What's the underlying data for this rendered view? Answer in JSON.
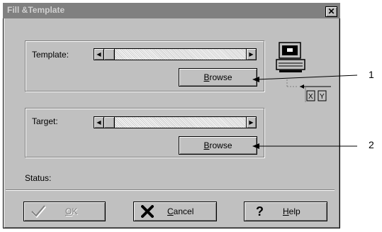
{
  "window": {
    "title": "Fill &Template",
    "close_glyph": "✕"
  },
  "template_group": {
    "label": "Template:",
    "browse_button": {
      "mnemonic": "B",
      "rest": "rowse"
    }
  },
  "target_group": {
    "label": "Target:",
    "browse_button": {
      "mnemonic": "B",
      "rest": "rowse"
    }
  },
  "status": {
    "label": "Status:"
  },
  "buttons": {
    "ok": {
      "mnemonic": "O",
      "rest": "K",
      "enabled": false
    },
    "cancel": {
      "mnemonic": "C",
      "rest": "ancel"
    },
    "help": {
      "mnemonic": "H",
      "rest": "elp",
      "icon": "?"
    }
  },
  "graphic": {
    "x_label": "X",
    "y_label": "Y"
  },
  "callouts": [
    "1",
    "2"
  ],
  "icons": {
    "close": "close-icon",
    "computer": "computer-icon",
    "ok": "checkmark-icon",
    "cancel": "x-mark-icon",
    "help": "question-icon",
    "slider_left": "arrow-left-icon",
    "slider_right": "arrow-right-icon"
  }
}
